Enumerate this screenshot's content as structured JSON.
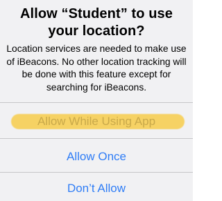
{
  "dialog": {
    "title": "Allow “Student” to use your location?",
    "message": "Location services are needed to make use of iBeacons. No other location tracking will be done with this feature except for searching for iBeacons."
  },
  "actions": [
    {
      "label": "Allow While Using App",
      "highlighted": true
    },
    {
      "label": "Allow Once",
      "highlighted": false
    },
    {
      "label": "Don’t Allow",
      "highlighted": false
    }
  ],
  "colors": {
    "background": "#f1f1f3",
    "action_text": "#2f7df6",
    "divider": "#c6c6c8",
    "highlight": "#f7cf55"
  }
}
